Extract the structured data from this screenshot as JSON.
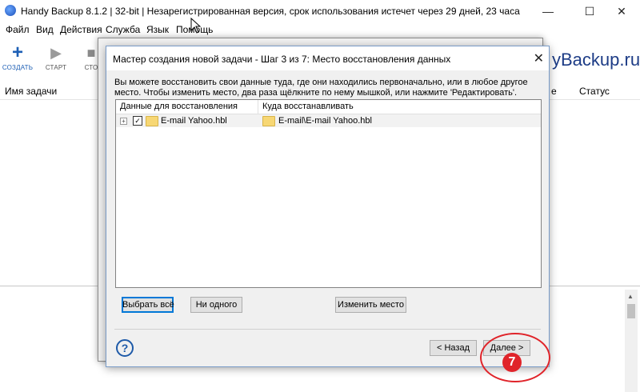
{
  "window": {
    "title": "Handy Backup 8.1.2 | 32-bit | Незарегистрированная версия, срок использования истечет через  29 дней, 23 часа",
    "minimize": "—",
    "maximize": "☐",
    "close": "✕"
  },
  "menu": [
    "Файл",
    "Вид",
    "Действия",
    "Служба",
    "Язык",
    "Помощь"
  ],
  "toolbar": {
    "create_label": "СОЗДАТЬ",
    "start_label": "СТАРТ",
    "stop_label": "СТО"
  },
  "brand": "yBackup.ru",
  "task_list": {
    "col_name": "Имя задачи",
    "col_partial": "е",
    "col_status": "Статус"
  },
  "dialog": {
    "title": "Мастер создания новой задачи - Шаг 3 из 7: Место восстановления данных",
    "description": "Вы можете восстановить свои данные туда, где они находились первоначально, или в любое другое место. Чтобы изменить место, два раза щёлкните по нему мышкой, или нажмите 'Редактировать'.",
    "col_data": "Данные для восстановления",
    "col_target": "Куда восстанавливать",
    "rows": [
      {
        "source": "E-mail Yahoo.hbl",
        "target": "E-mail\\E-mail Yahoo.hbl",
        "checked": "✓",
        "expander": "+"
      }
    ],
    "select_all": "Выбрать всё",
    "select_none": "Ни одного",
    "change_location": "Изменить место",
    "back": "< Назад",
    "next": "Далее >",
    "help": "?"
  },
  "annotation": {
    "step": "7",
    "color": "#e0242a"
  }
}
